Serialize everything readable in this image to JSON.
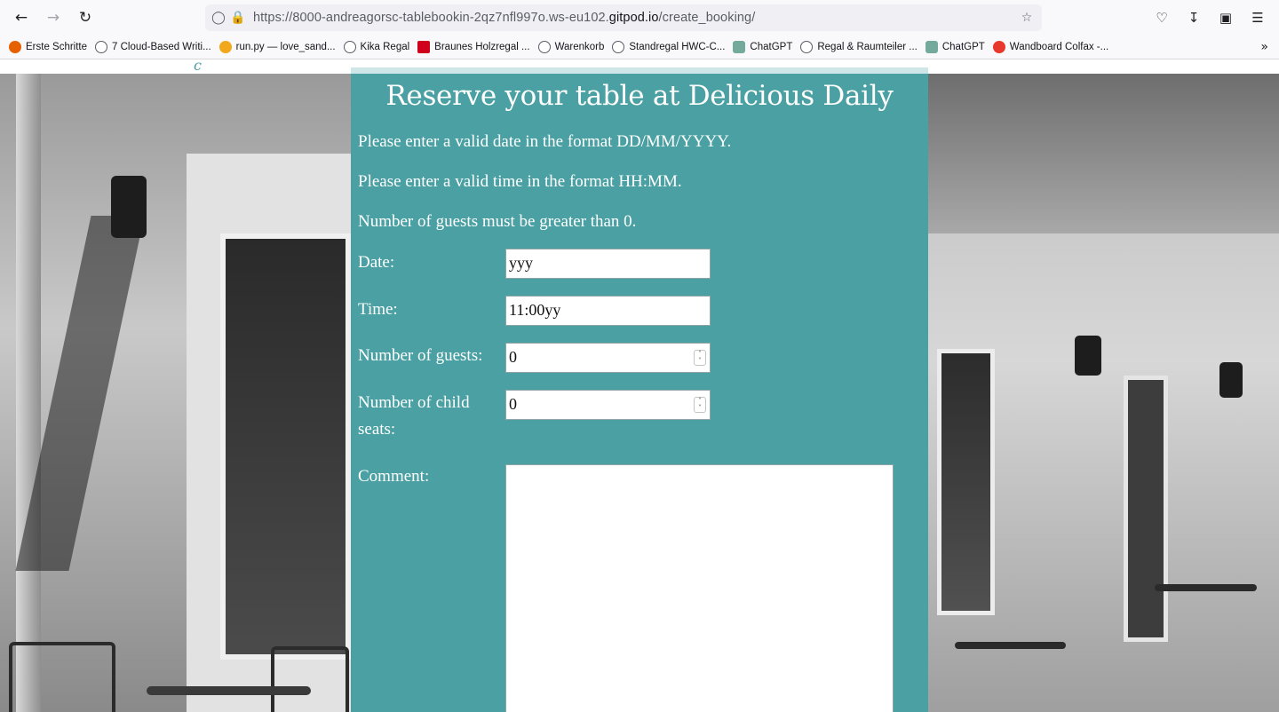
{
  "browser": {
    "url_prefix": "https://8000-andreagorsc-tablebookin-2qz7nfl997o.ws-eu102.",
    "url_domain": "gitpod.io",
    "url_path": "/create_booking/"
  },
  "bookmarks": [
    {
      "label": "Erste Schritte",
      "color": "#e66000"
    },
    {
      "label": "7 Cloud-Based Writi...",
      "color": "#5b5b66"
    },
    {
      "label": "run.py — love_sand...",
      "color": "#f1a81b"
    },
    {
      "label": "Kika Regal",
      "color": "#5b5b66"
    },
    {
      "label": "Braunes Holzregal ...",
      "color": "#d0021b"
    },
    {
      "label": "Warenkorb",
      "color": "#5b5b66"
    },
    {
      "label": "Standregal HWC-C...",
      "color": "#5b5b66"
    },
    {
      "label": "ChatGPT",
      "color": "#74aa9c"
    },
    {
      "label": "Regal & Raumteiler ...",
      "color": "#5b5b66"
    },
    {
      "label": "ChatGPT",
      "color": "#74aa9c"
    },
    {
      "label": "Wandboard Colfax -...",
      "color": "#e8382c"
    }
  ],
  "booking": {
    "title": "Reserve your table at Delicious Daily",
    "errors": [
      "Please enter a valid date in the format DD/MM/YYYY.",
      "Please enter a valid time in the format HH:MM.",
      "Number of guests must be greater than 0."
    ],
    "date_label": "Date:",
    "date_value": "yyy",
    "time_label": "Time:",
    "time_value": "11:00yy",
    "guests_label": "Number of guests:",
    "guests_value": "0",
    "child_seats_label_1": "Number of child",
    "child_seats_label_2": "seats:",
    "child_seats_value": "0",
    "comment_label": "Comment:"
  },
  "colors": {
    "panel": "#4aa0a2",
    "panel_top": "#cfe6e8"
  }
}
